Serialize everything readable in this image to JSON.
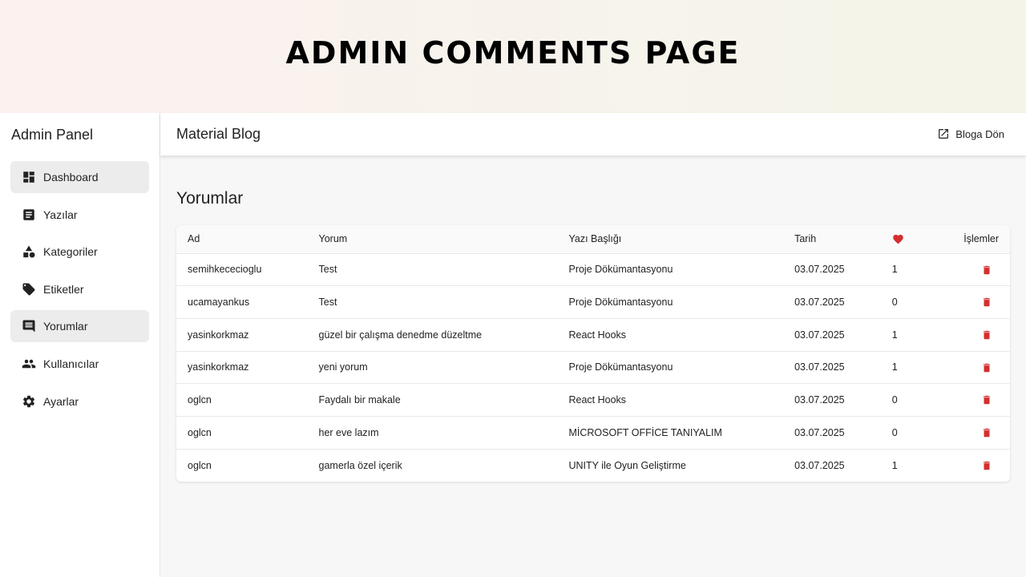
{
  "banner": {
    "title": "ADMIN COMMENTS PAGE"
  },
  "sidebar": {
    "title": "Admin Panel",
    "items": [
      {
        "label": "Dashboard",
        "icon": "dashboard-icon",
        "active": true
      },
      {
        "label": "Yazılar",
        "icon": "article-icon",
        "active": false
      },
      {
        "label": "Kategoriler",
        "icon": "category-icon",
        "active": false
      },
      {
        "label": "Etiketler",
        "icon": "tag-icon",
        "active": false
      },
      {
        "label": "Yorumlar",
        "icon": "comment-icon",
        "active": true
      },
      {
        "label": "Kullanıcılar",
        "icon": "people-icon",
        "active": false
      },
      {
        "label": "Ayarlar",
        "icon": "gear-icon",
        "active": false
      }
    ]
  },
  "appbar": {
    "title": "Material Blog",
    "back_label": "Bloga Dön"
  },
  "main": {
    "heading": "Yorumlar",
    "table": {
      "headers": {
        "ad": "Ad",
        "yorum": "Yorum",
        "baslik": "Yazı Başlığı",
        "tarih": "Tarih",
        "like": "heart-icon",
        "ops": "İşlemler"
      },
      "rows": [
        {
          "ad": "semihkececioglu",
          "yorum": "Test",
          "baslik": "Proje Dökümantasyonu",
          "tarih": "03.07.2025",
          "likes": "1"
        },
        {
          "ad": "ucamayankus",
          "yorum": "Test",
          "baslik": "Proje Dökümantasyonu",
          "tarih": "03.07.2025",
          "likes": "0"
        },
        {
          "ad": "yasinkorkmaz",
          "yorum": "güzel bir çalışma denedme düzeltme",
          "baslik": "React Hooks",
          "tarih": "03.07.2025",
          "likes": "1"
        },
        {
          "ad": "yasinkorkmaz",
          "yorum": "yeni yorum",
          "baslik": "Proje Dökümantasyonu",
          "tarih": "03.07.2025",
          "likes": "1"
        },
        {
          "ad": "oglcn",
          "yorum": "Faydalı bir makale",
          "baslik": "React Hooks",
          "tarih": "03.07.2025",
          "likes": "0"
        },
        {
          "ad": "oglcn",
          "yorum": "her eve lazım",
          "baslik": "MİCROSOFT OFFİCE TANIYALIM",
          "tarih": "03.07.2025",
          "likes": "0"
        },
        {
          "ad": "oglcn",
          "yorum": "gamerla özel içerik",
          "baslik": "UNITY ile Oyun Geliştirme",
          "tarih": "03.07.2025",
          "likes": "1"
        }
      ]
    }
  },
  "colors": {
    "accent_red": "#d32f2f",
    "active_nav_bg": "#ececec"
  }
}
